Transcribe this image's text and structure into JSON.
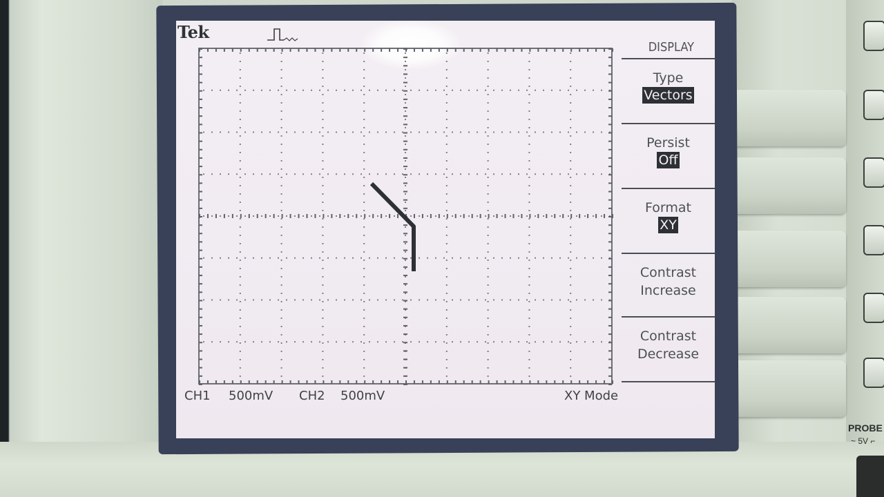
{
  "screen": {
    "brand": "Tek",
    "trigger_icon": "trigger-pulse-icon"
  },
  "menu": {
    "title": "DISPLAY",
    "items": [
      {
        "label": "Type",
        "value": "Vectors"
      },
      {
        "label": "Persist",
        "value": "Off"
      },
      {
        "label": "Format",
        "value": "XY"
      },
      {
        "label": "Contrast",
        "label2": "Increase"
      },
      {
        "label": "Contrast",
        "label2": "Decrease"
      }
    ]
  },
  "status": {
    "ch1_label": "CH1",
    "ch1_scale": "500mV",
    "ch2_label": "CH2",
    "ch2_scale": "500mV",
    "mode": "XY Mode"
  },
  "panel": {
    "probe_label": "PROBE",
    "probe_sub": "~ 5V ⌐"
  },
  "colors": {
    "screen_bg": "#f3eef3",
    "trace": "#2d3034",
    "bezel": "#394158"
  }
}
